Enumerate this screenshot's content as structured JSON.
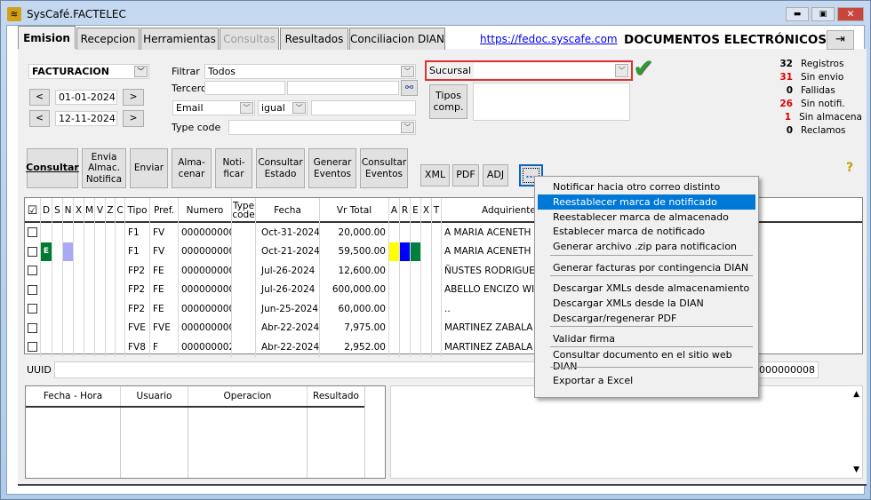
{
  "window": {
    "title": "SysCafé.FACTELEC",
    "min_icon": "minimize-icon",
    "max_icon": "maximize-icon",
    "close_icon": "close-icon"
  },
  "tabs": [
    {
      "label": "Emision",
      "selected": true
    },
    {
      "label": "Recepcion"
    },
    {
      "label": "Herramientas"
    },
    {
      "label": "Consultas",
      "disabled": true
    },
    {
      "label": "Resultados"
    },
    {
      "label": "Conciliacion DIAN"
    }
  ],
  "header": {
    "link": "https://fedoc.syscafe.com",
    "title": "DOCUMENTOS ELECTRÓNICOS",
    "exit_icon": "exit-door-icon"
  },
  "filters": {
    "module": "FACTURACION",
    "date_from": "01-01-2024",
    "date_to": "12-11-2024",
    "prev": "<",
    "next": ">",
    "filtrar_label": "Filtrar",
    "filtrar_value": "Todos",
    "tercero_label": "Tercero",
    "tercero_value1": "",
    "tercero_value2": "",
    "field": "Email",
    "operator": "igual",
    "field_value": "",
    "type_code_label": "Type code",
    "type_code_value": "",
    "sucursal_label": "Sucursal",
    "sucursal_value": "",
    "tipos_comp": "Tipos comp.",
    "tipos_comp_value": ""
  },
  "stats": [
    {
      "value": "32",
      "label": "Registros",
      "color": "#000000"
    },
    {
      "value": "31",
      "label": "Sin envio",
      "color": "#e00000"
    },
    {
      "value": "0",
      "label": "Fallidas",
      "color": "#000000"
    },
    {
      "value": "26",
      "label": "Sin notifi.",
      "color": "#e00000"
    },
    {
      "value": "1",
      "label": "Sin almacena",
      "color": "#e00000"
    },
    {
      "value": "0",
      "label": "Reclamos",
      "color": "#000000"
    }
  ],
  "toolbar": {
    "consultar": "Consultar",
    "envia": "Envia Almac. Notifica",
    "enviar": "Enviar",
    "almacenar": "Alma- cenar",
    "notificar": "Noti- ficar",
    "consultar_estado": "Consultar Estado",
    "generar_eventos": "Generar Eventos",
    "consultar_eventos": "Consultar Eventos",
    "xml": "XML",
    "pdf": "PDF",
    "adj": "ADJ",
    "more": "...",
    "help_icon": "help-icon"
  },
  "grid": {
    "headers": [
      "☑",
      "D",
      "S",
      "N",
      "X",
      "M",
      "V",
      "Z",
      "C",
      "Tipo",
      "Pref.",
      "Numero",
      "Type code",
      "Fecha",
      "Vr Total",
      "A",
      "R",
      "E",
      "X",
      "T",
      "Adquiriente"
    ],
    "rows": [
      {
        "d": "",
        "tipo": "F1",
        "pref": "FV",
        "numero": "0000000002",
        "fecha": "Oct-31-2024",
        "total": "20,000.00",
        "adq": "A MARIA ACENETH"
      },
      {
        "d": "E",
        "tipo": "F1",
        "pref": "FV",
        "numero": "0000000001",
        "fecha": "Oct-21-2024",
        "total": "59,500.00",
        "adq": "A MARIA ACENETH",
        "flags": true
      },
      {
        "d": "",
        "tipo": "FP2",
        "pref": "FE",
        "numero": "0000000007",
        "fecha": "Jul-26-2024",
        "total": "12,600.00",
        "adq": "ÑUSTES RODRIGUEZ D"
      },
      {
        "d": "",
        "tipo": "FP2",
        "pref": "FE",
        "numero": "0000000006",
        "fecha": "Jul-26-2024",
        "total": "600,000.00",
        "adq": "ABELLO ENCIZO WILS"
      },
      {
        "d": "",
        "tipo": "FP2",
        "pref": "FE",
        "numero": "0000000005",
        "fecha": "Jun-25-2024",
        "total": "60,000.00",
        "adq": ".."
      },
      {
        "d": "",
        "tipo": "FVE",
        "pref": "FVE",
        "numero": "0000000001",
        "fecha": "Abr-22-2024",
        "total": "7,975.00",
        "adq": "MARTINEZ ZABALA V"
      },
      {
        "d": "",
        "tipo": "FV8",
        "pref": "F",
        "numero": "0000000025",
        "fecha": "Abr-22-2024",
        "total": "2,952.00",
        "adq": "MARTINEZ ZABALA V"
      }
    ],
    "colors": {
      "d_green": "#007a33",
      "n_lavender": "#a9a9f5",
      "a_yellow": "#ffff00",
      "r_blue": "#0000ff",
      "e_green": "#00803f"
    }
  },
  "context_menu": {
    "items": [
      "Notificar hacia otro correo distinto",
      "Reestablecer marca de notificado",
      "Reestablecer marca de almacenado",
      "Establecer marca de notificado",
      "Generar archivo .zip para notificacion",
      "Generar facturas por contingencia DIAN",
      "Descargar XMLs desde almacenamiento",
      "Descargar XMLs desde la DIAN",
      "Descargar/regenerar PDF",
      "Validar firma",
      "Consultar documento en el sitio web DIAN",
      "Exportar a Excel"
    ],
    "highlighted": 1,
    "highlight_color": "#0078d7"
  },
  "uuid": {
    "label": "UUID",
    "value": "",
    "doc": "-0000000008"
  },
  "log": {
    "headers": [
      "Fecha - Hora",
      "Usuario",
      "Operacion",
      "Resultado"
    ]
  }
}
